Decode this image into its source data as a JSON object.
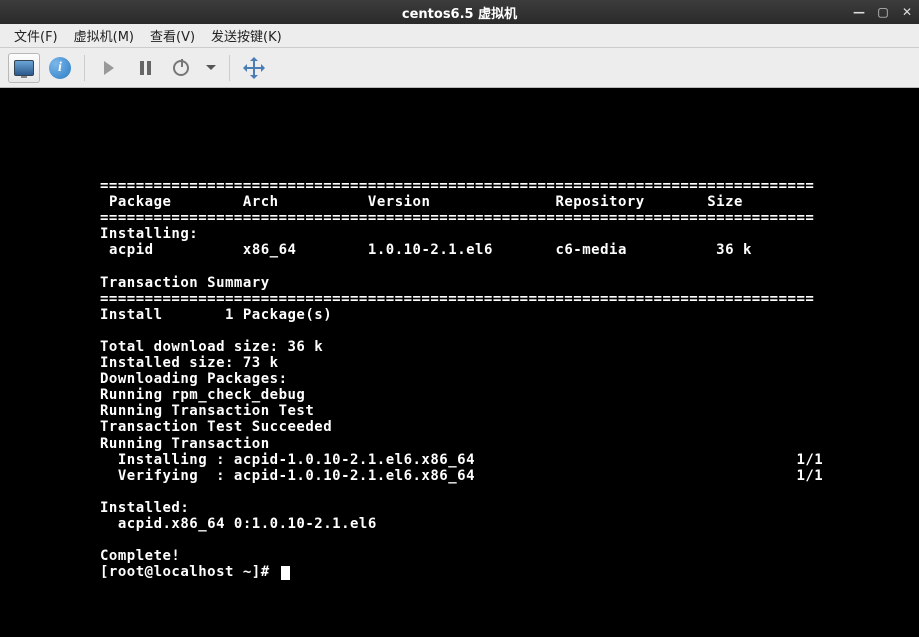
{
  "titlebar": {
    "appname": "",
    "title": "centos6.5 虚拟机"
  },
  "menu": {
    "file": "文件(F)",
    "vm": "虚拟机(M)",
    "view": "查看(V)",
    "sendkey": "发送按键(K)"
  },
  "terminal": {
    "divider": "================================================================================",
    "header_package": "Package",
    "header_arch": "Arch",
    "header_version": "Version",
    "header_repo": "Repository",
    "header_size": "Size",
    "section_installing": "Installing:",
    "row": {
      "package": "acpid",
      "arch": "x86_64",
      "version": "1.0.10-2.1.el6",
      "repo": "c6-media",
      "size": "36 k"
    },
    "trans_summary": "Transaction Summary",
    "install_line": "Install       1 Package(s)",
    "total_dl": "Total download size: 36 k",
    "installed_size": "Installed size: 73 k",
    "dl_packages": "Downloading Packages:",
    "run_check": "Running rpm_check_debug",
    "run_test": "Running Transaction Test",
    "test_ok": "Transaction Test Succeeded",
    "run_trans": "Running Transaction",
    "installing_pkg": "  Installing : acpid-1.0.10-2.1.el6.x86_64",
    "progress1": "1/1",
    "verifying_pkg": "  Verifying  : acpid-1.0.10-2.1.el6.x86_64",
    "progress2": "1/1",
    "installed": "Installed:",
    "installed_pkg": "  acpid.x86_64 0:1.0.10-2.1.el6",
    "complete": "Complete!",
    "prompt": "[root@localhost ~]# "
  }
}
